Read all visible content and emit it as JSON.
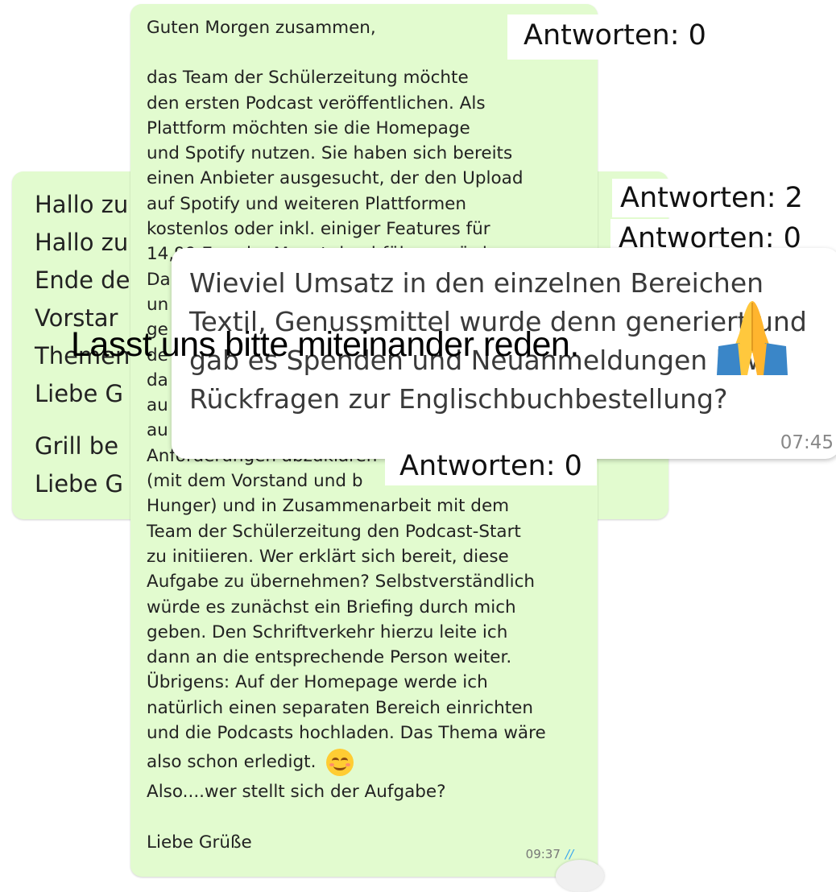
{
  "left_bubble": {
    "lines": [
      "Hallo zu",
      "Hallo zu",
      "Ende de",
      "Vorstar",
      "Themen",
      "Liebe G"
    ],
    "lines2": [
      "Grill be",
      "Liebe G"
    ],
    "ticks": "//"
  },
  "main_bubble": {
    "greeting": "Guten Morgen zusammen,",
    "body_lines": [
      "das Team der Schülerzeitung möchte",
      "den ersten Podcast veröffentlichen. Als",
      "Plattform möchten sie die Homepage",
      "und Spotify nutzen. Sie haben sich bereits",
      "einen Anbieter ausgesucht, der den Upload",
      "auf Spotify und weiteren Plattformen",
      "kostenlos oder inkl. einiger Features für",
      "14,99 Euro im Monat durchführen würde.",
      "Da",
      "un",
      "ge",
      "de",
      "da",
      "au",
      "au",
      "Anforderungen abzuklären",
      "(mit dem Vorstand und b",
      "Hunger) und in Zusammenarbeit mit dem",
      "Team der Schülerzeitung den Podcast-Start",
      "zu initiieren. Wer erklärt sich bereit, diese",
      "Aufgabe zu übernehmen? Selbstverständlich",
      "würde es zunächst ein Briefing durch mich",
      "geben. Den Schriftverkehr hierzu leite ich",
      "dann an die entsprechende Person weiter.",
      "Übrigens: Auf der Homepage werde ich",
      "natürlich einen separaten Bereich einrichten",
      "und die Podcasts hochladen. Das Thema wäre"
    ],
    "last_line": "also schon erledigt.",
    "question": "Also....wer stellt sich der Aufgabe?",
    "closing": "Liebe Grüße",
    "time": "09:37",
    "ticks": "//"
  },
  "white_bubble": {
    "lines": [
      "Wieviel Umsatz in den einzelnen Bereichen",
      "Textil, Genussmittel wurde denn generiert und",
      "gab es Spenden und Neuanmeldungen bzw.",
      "Rückfragen zur Englischbuchbestellung?"
    ],
    "time": "07:45"
  },
  "reply_labels": {
    "top": "Antworten: 0",
    "middle_a": "Antworten: 2",
    "middle_b": "Antworten: 0",
    "bottom": "Antworten: 0"
  },
  "overlay_text": "Lasst uns bitte miteinander reden.",
  "icons": {
    "emoji_smile": "smiling-face-icon",
    "emoji_pray": "folded-hands-icon"
  }
}
